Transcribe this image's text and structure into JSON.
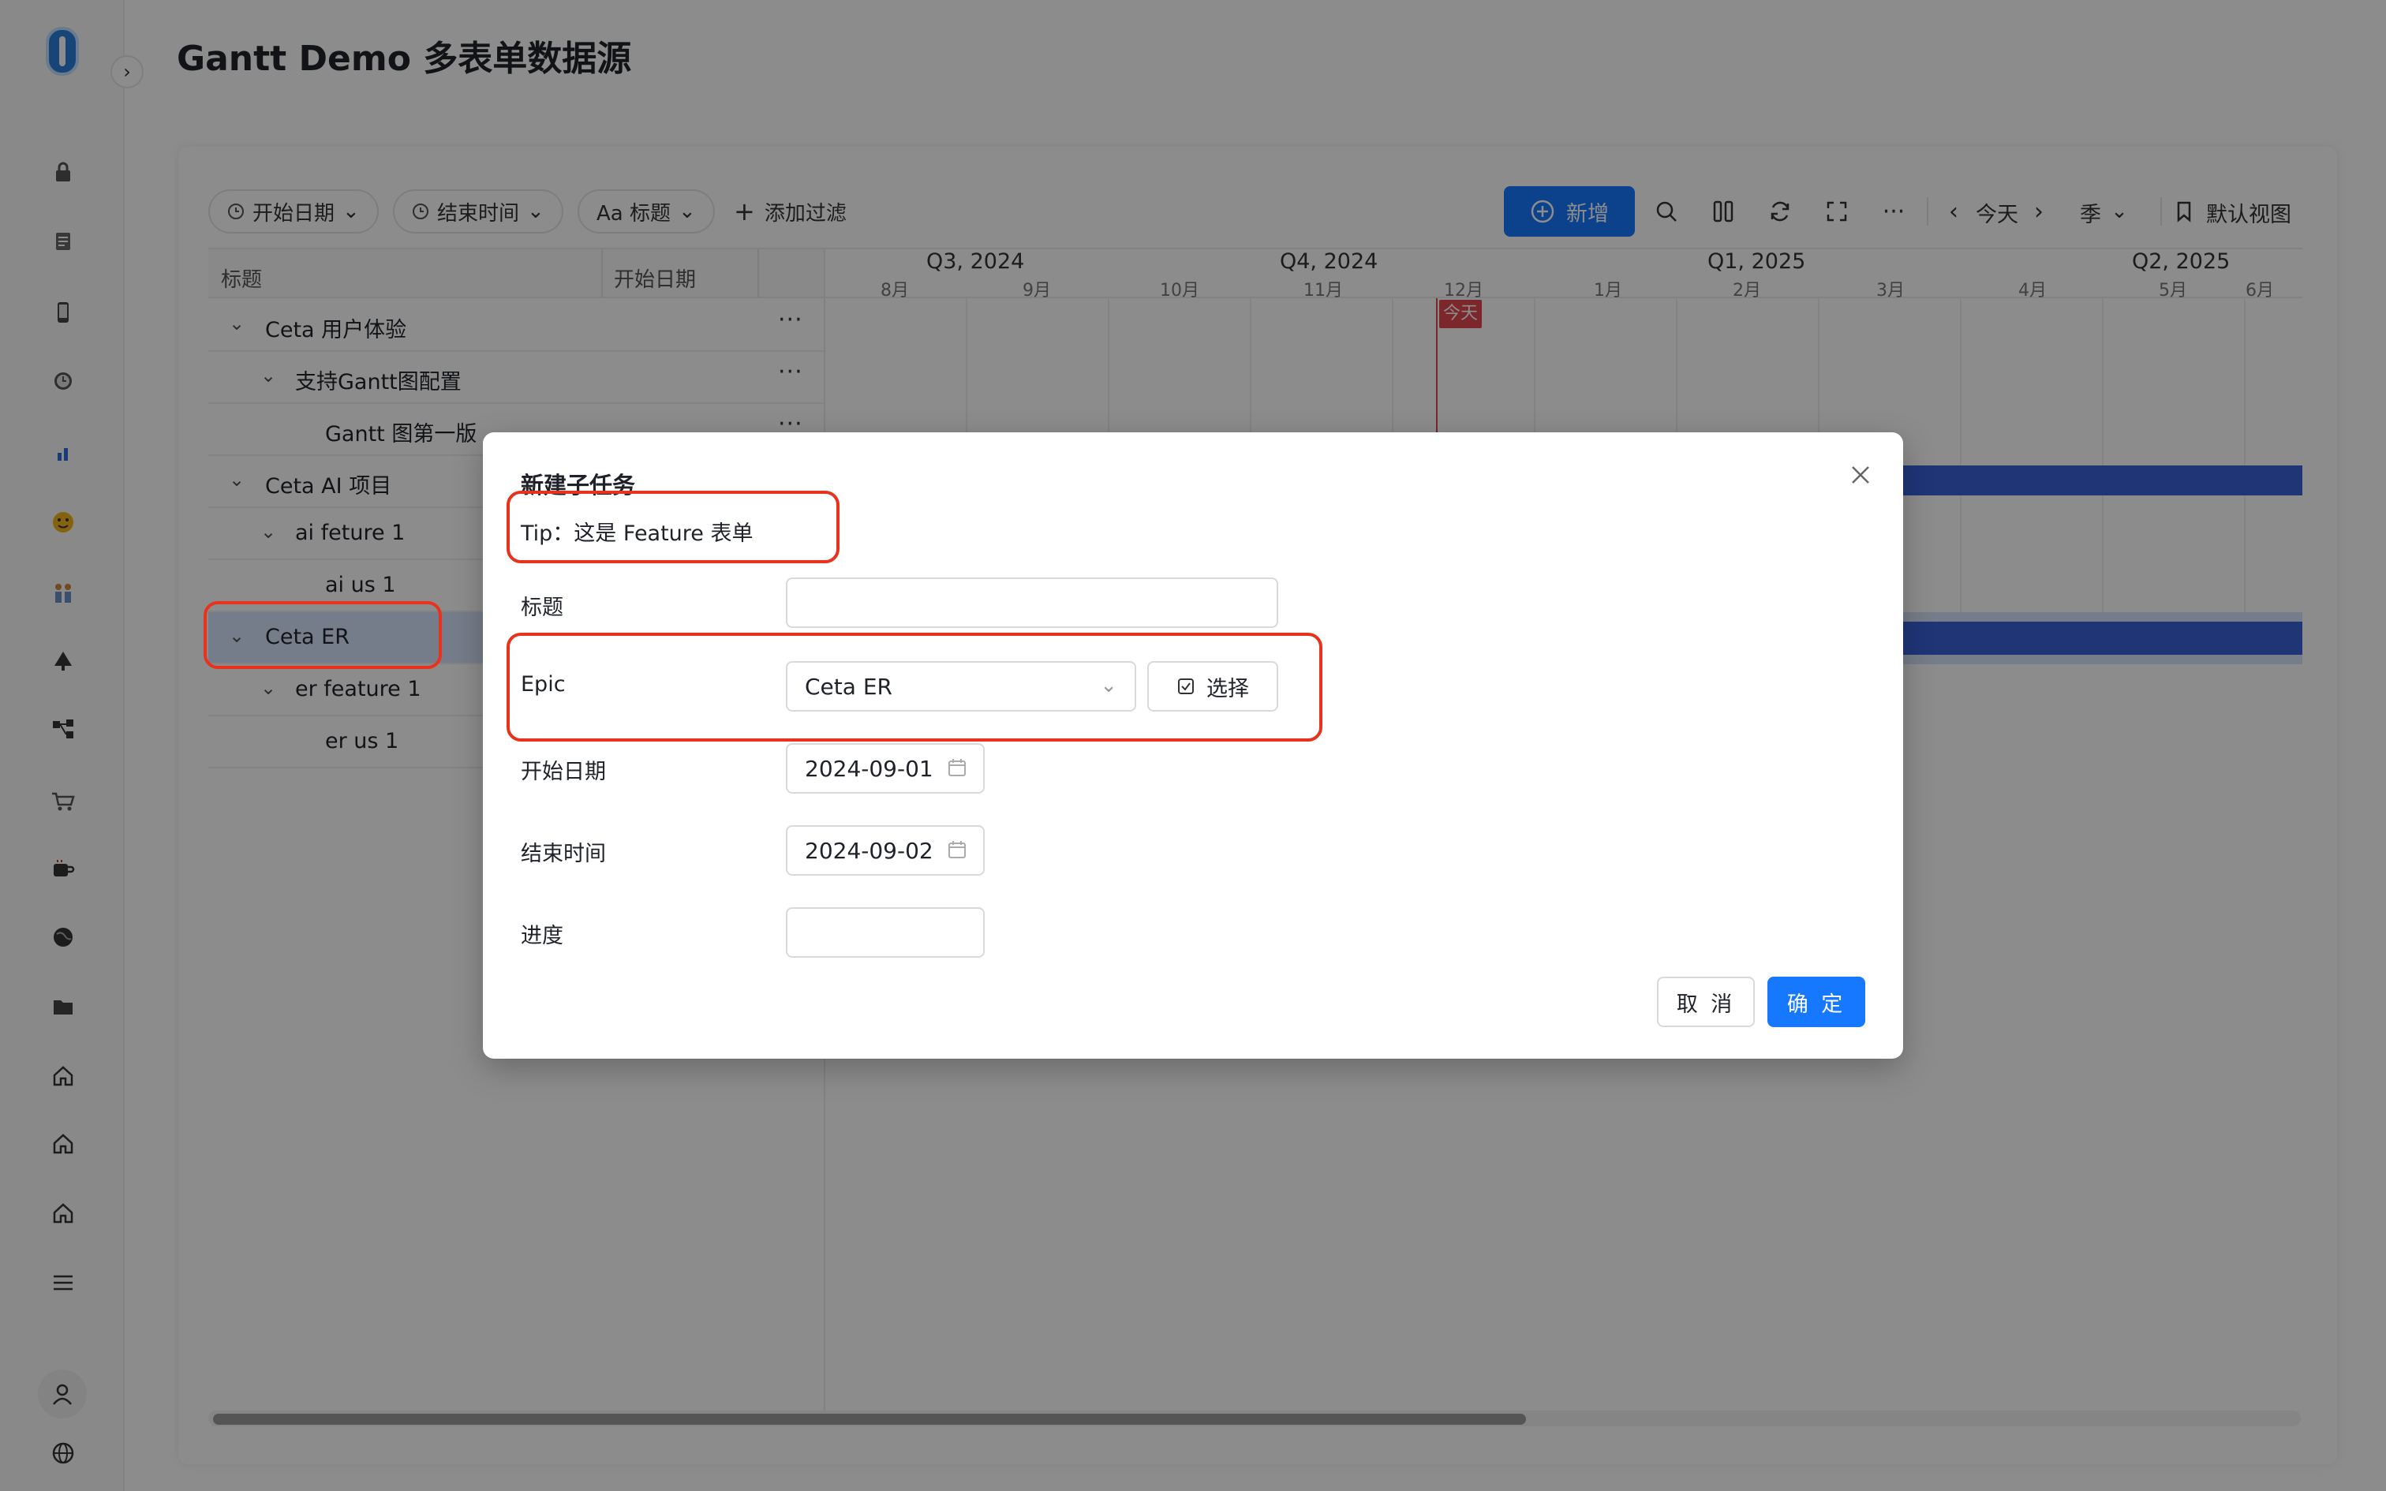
{
  "page": {
    "title": "Gantt Demo 多表单数据源"
  },
  "sidebar": {
    "icons": [
      "lock-icon",
      "document-icon",
      "phone-icon",
      "alarm-icon",
      "chart-icon",
      "emoji-icon",
      "people-icon",
      "tree-icon",
      "network-icon",
      "cart-icon",
      "coffee-icon",
      "globe-icon",
      "folder-icon",
      "home-icon",
      "home-icon",
      "home-icon",
      "menu-icon"
    ]
  },
  "toolbar": {
    "filters": [
      "开始日期",
      "结束时间",
      "Aa 标题"
    ],
    "add_filter": "添加过滤",
    "new_label": "新增",
    "today_label": "今天",
    "scale_label": "季",
    "view_label": "默认视图"
  },
  "table": {
    "columns": [
      "标题",
      "开始日期"
    ],
    "rows": [
      {
        "label": "Ceta 用户体验",
        "level": 0,
        "expanded": true,
        "has_more": true
      },
      {
        "label": "支持Gantt图配置",
        "level": 1,
        "expanded": true,
        "has_more": true
      },
      {
        "label": "Gantt 图第一版",
        "level": 2,
        "expanded": false,
        "has_more": true
      },
      {
        "label": "Ceta AI 项目",
        "level": 0,
        "expanded": true,
        "has_more": false
      },
      {
        "label": "ai feture 1",
        "level": 1,
        "expanded": true,
        "has_more": false
      },
      {
        "label": "ai us 1",
        "level": 2,
        "expanded": false,
        "has_more": false
      },
      {
        "label": "Ceta ER",
        "level": 0,
        "expanded": true,
        "has_more": false,
        "selected": true
      },
      {
        "label": "er feature 1",
        "level": 1,
        "expanded": true,
        "has_more": false
      },
      {
        "label": "er us 1",
        "level": 2,
        "expanded": false,
        "has_more": false
      }
    ]
  },
  "timeline": {
    "quarters": [
      "Q3, 2024",
      "Q4, 2024",
      "Q1, 2025",
      "Q2, 2025"
    ],
    "months": [
      "8月",
      "9月",
      "10月",
      "11月",
      "12月",
      "1月",
      "2月",
      "3月",
      "4月",
      "5月",
      "6月"
    ],
    "today_label": "今天",
    "today": "2024-12"
  },
  "modal": {
    "title": "新建子任务",
    "tip": "Tip：这是 Feature 表单",
    "fields": {
      "title_label": "标题",
      "title_value": "",
      "epic_label": "Epic",
      "epic_value": "Ceta ER",
      "choose_label": "选择",
      "start_label": "开始日期",
      "start_value": "2024-09-01",
      "end_label": "结束时间",
      "end_value": "2024-09-02",
      "progress_label": "进度",
      "progress_value": ""
    },
    "cancel_label": "取 消",
    "ok_label": "确 定"
  },
  "colors": {
    "primary": "#1677ff",
    "bar": "#3a62d8",
    "today": "#e0474f",
    "highlight": "#e8321e"
  }
}
